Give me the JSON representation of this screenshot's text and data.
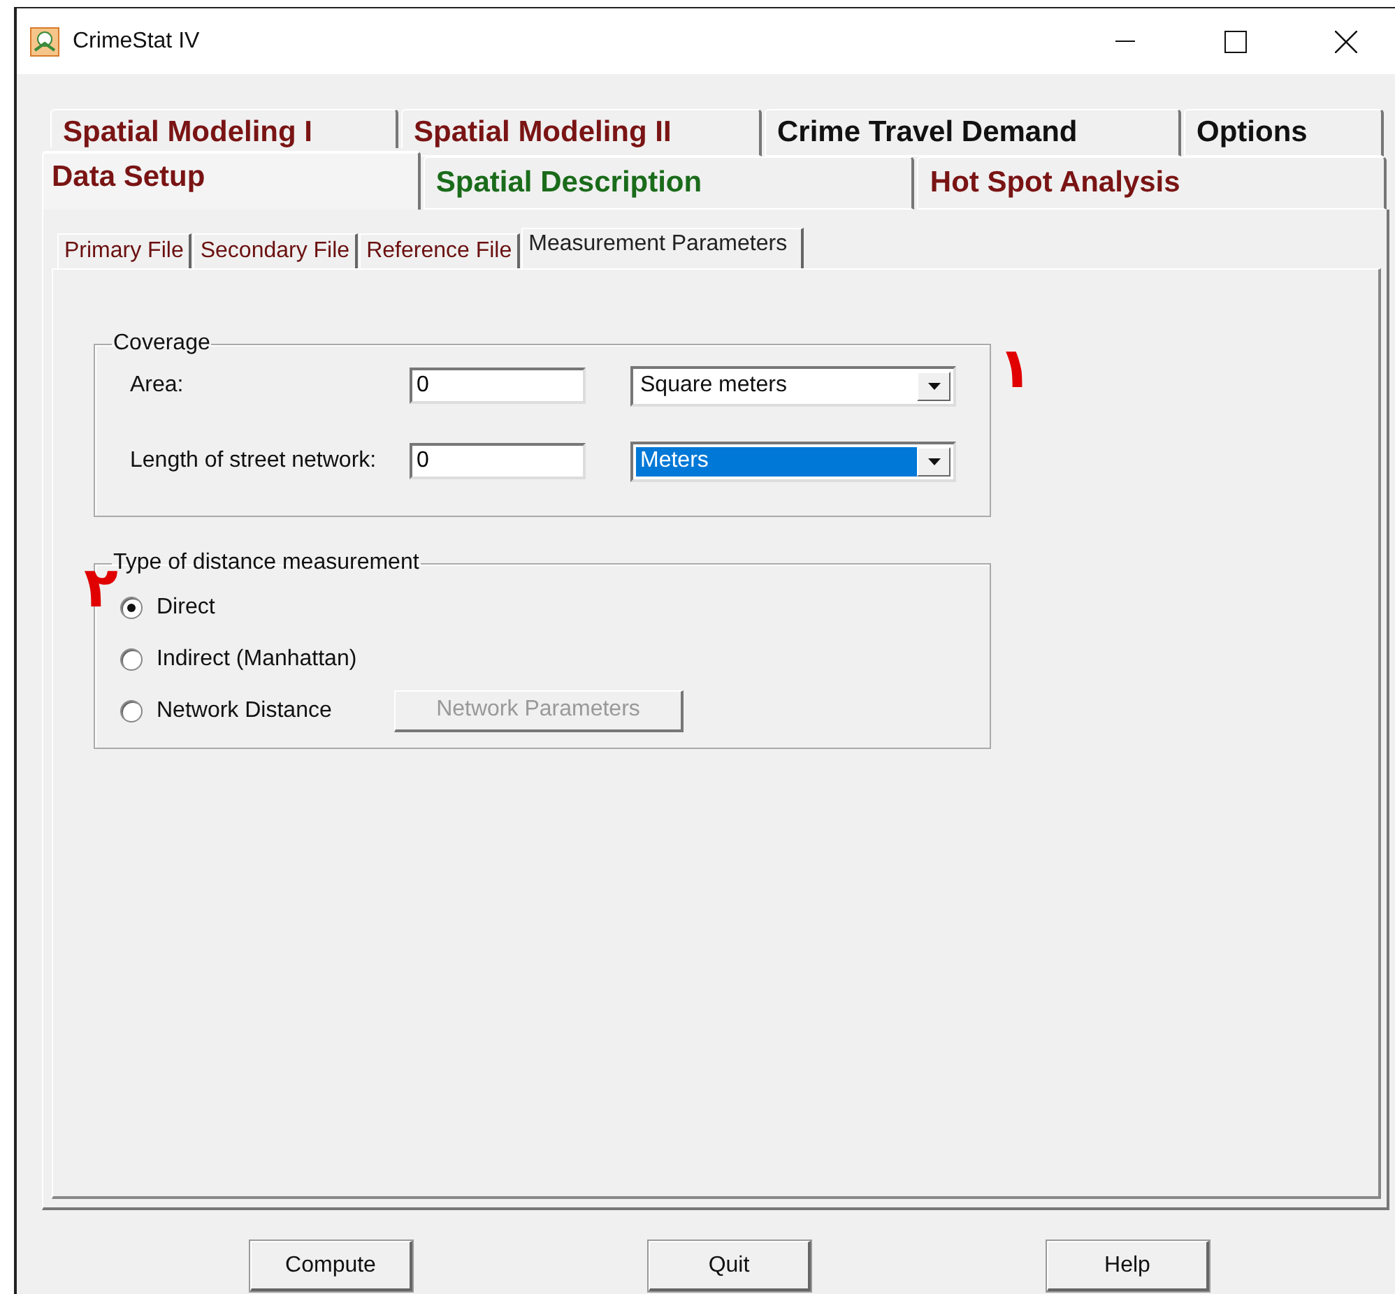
{
  "window": {
    "title": "CrimeStat IV"
  },
  "tab_rows": [
    {
      "tabs": [
        {
          "label": "Spatial Modeling I",
          "color": "#7a1414",
          "selected": false
        },
        {
          "label": "Spatial Modeling II",
          "color": "#7a1414",
          "selected": false
        },
        {
          "label": "Crime Travel Demand",
          "color": "#111111",
          "selected": false
        },
        {
          "label": "Options",
          "color": "#111111",
          "selected": false
        }
      ]
    },
    {
      "tabs": [
        {
          "label": "Data Setup",
          "color": "#7a1414",
          "selected": true
        },
        {
          "label": "Spatial Description",
          "color": "#1a6b1a",
          "selected": false
        },
        {
          "label": "Hot Spot Analysis",
          "color": "#7a1414",
          "selected": false
        }
      ]
    }
  ],
  "sub_tabs": [
    {
      "label": "Primary File",
      "selected": false
    },
    {
      "label": "Secondary File",
      "selected": false
    },
    {
      "label": "Reference File",
      "selected": false
    },
    {
      "label": "Measurement Parameters",
      "selected": true
    }
  ],
  "coverage": {
    "title": "Coverage",
    "rows": [
      {
        "label": "Area:",
        "value": "0",
        "unit": "Square meters",
        "unit_highlighted": false
      },
      {
        "label": "Length of street network:",
        "value": "0",
        "unit": "Meters",
        "unit_highlighted": true
      }
    ]
  },
  "distance": {
    "title": "Type of distance measurement",
    "options": [
      {
        "label": "Direct",
        "selected": true
      },
      {
        "label": "Indirect (Manhattan)",
        "selected": false
      },
      {
        "label": "Network Distance",
        "selected": false
      }
    ],
    "network_button": {
      "label": "Network Parameters",
      "disabled": true
    }
  },
  "buttons": [
    "Compute",
    "Quit",
    "Help"
  ],
  "annotations": [
    {
      "text": "١"
    },
    {
      "text": "٢"
    }
  ]
}
